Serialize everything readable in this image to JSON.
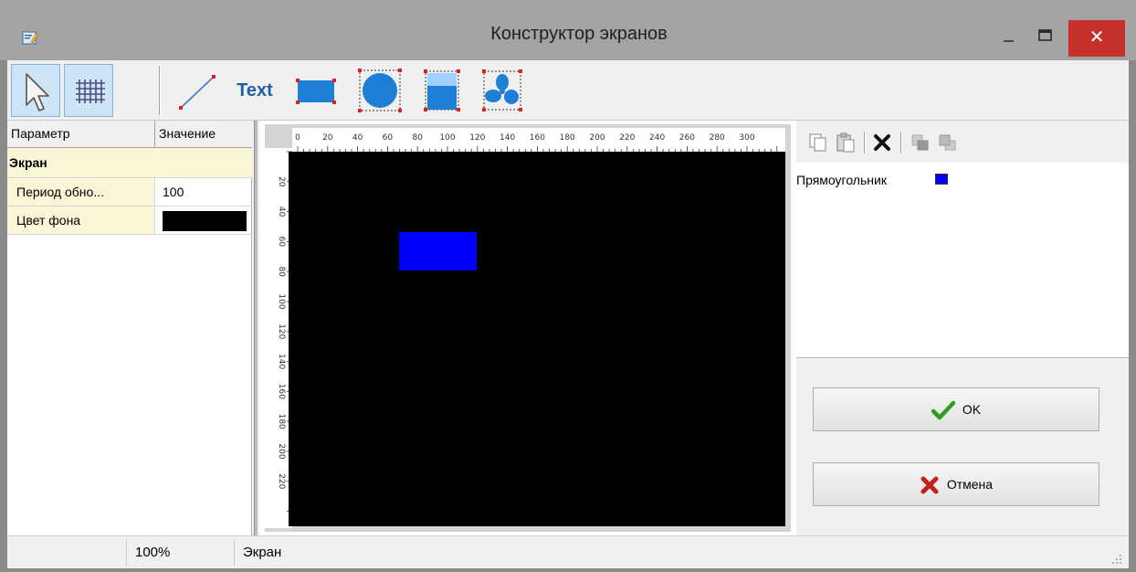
{
  "window": {
    "title": "Конструктор экранов",
    "close_glyph": "✕",
    "accent_close": "#c7312c"
  },
  "toolbar": {
    "tools": [
      {
        "name": "select-tool",
        "icon": "pointer-arrow-icon",
        "active": true
      },
      {
        "name": "grid-tool",
        "icon": "grid-icon",
        "active": true
      },
      {
        "name": "line-tool",
        "icon": "line-icon"
      },
      {
        "name": "text-tool",
        "label": "Text"
      },
      {
        "name": "rectangle-tool",
        "icon": "rectangle-icon"
      },
      {
        "name": "circle-tool",
        "icon": "circle-icon"
      },
      {
        "name": "tank-tool",
        "icon": "tank-icon"
      },
      {
        "name": "fan-tool",
        "icon": "fan-icon"
      }
    ],
    "text_label": "Text"
  },
  "properties": {
    "col_param": "Параметр",
    "col_value": "Значение",
    "section": "Экран",
    "rows": [
      {
        "key": "Период обно...",
        "value": "100"
      },
      {
        "key": "Цвет фона",
        "value_color": "#000000"
      }
    ]
  },
  "canvas": {
    "ruler_top": [
      "0",
      "20",
      "40",
      "60",
      "80",
      "100",
      "120",
      "140",
      "160",
      "180",
      "200",
      "220",
      "240",
      "260",
      "280",
      "300"
    ],
    "ruler_left": [
      "20",
      "40",
      "60",
      "80",
      "100",
      "120",
      "140",
      "160",
      "180",
      "200",
      "220"
    ],
    "background": "#000000",
    "shape_color": "#0000ff"
  },
  "objects": {
    "icons": [
      "copy-icon",
      "paste-icon",
      "delete-icon",
      "bring-front-icon",
      "send-back-icon"
    ],
    "items": [
      {
        "label": "Прямоугольник",
        "color": "#0000ff"
      }
    ]
  },
  "buttons": {
    "ok_label": "OK",
    "cancel_label": "Отмена"
  },
  "status": {
    "zoom": "100%",
    "context": "Экран"
  }
}
